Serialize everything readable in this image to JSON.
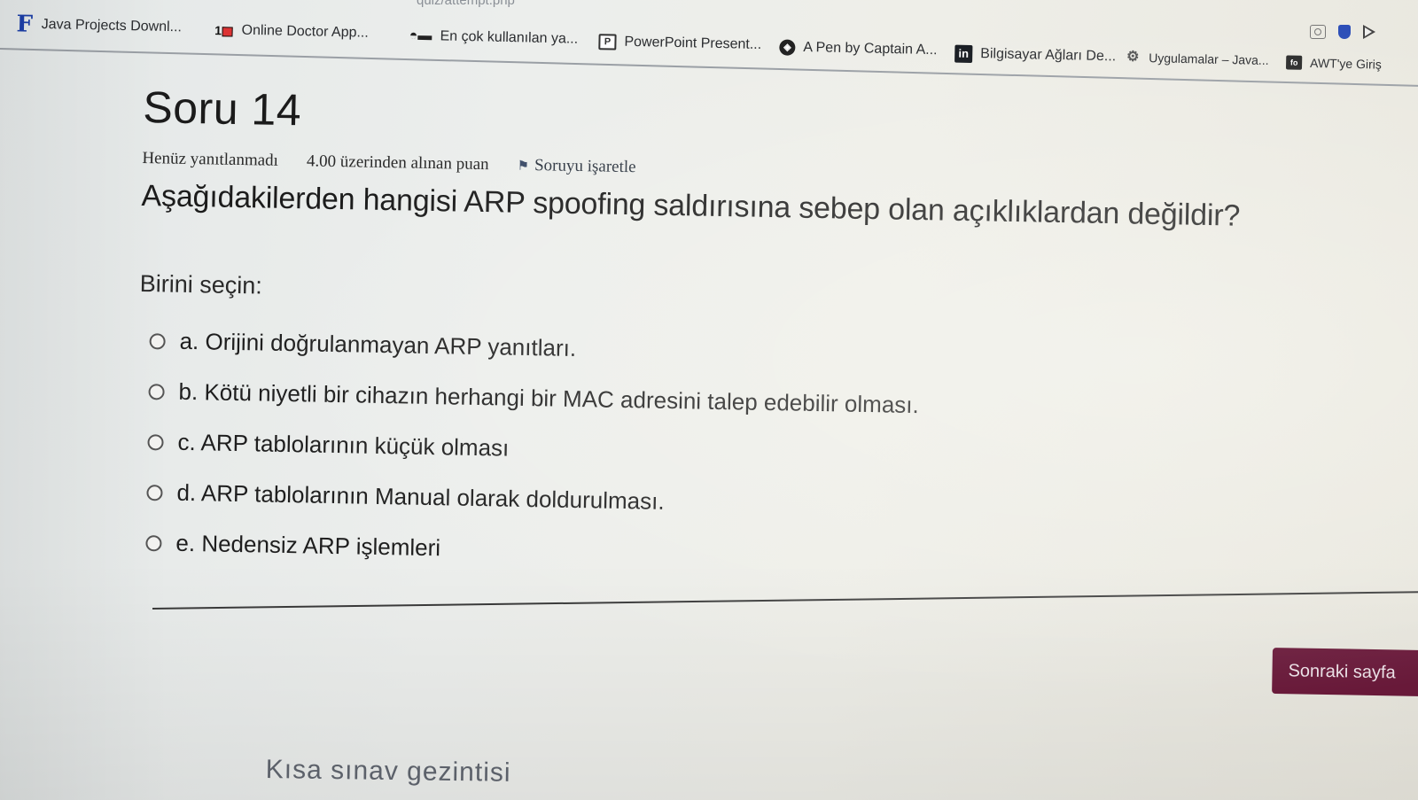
{
  "browser": {
    "url_fragment": "quiz/attempt.php",
    "bookmarks": [
      {
        "label": "Java Projects Downl...",
        "icon": "f-logo-icon"
      },
      {
        "label": "Online Doctor App...",
        "icon": "10-logo-icon"
      },
      {
        "label": "En çok kullanılan ya...",
        "icon": "car-icon"
      },
      {
        "label": "PowerPoint Present...",
        "icon": "powerpoint-icon"
      },
      {
        "label": "A Pen by Captain A...",
        "icon": "codepen-icon"
      },
      {
        "label": "Bilgisayar Ağları De...",
        "icon": "linkedin-icon"
      },
      {
        "label": "Uygulamalar – Java...",
        "icon": "apps-icon"
      },
      {
        "label": "AWT'ye Giriş",
        "icon": "awt-icon"
      }
    ],
    "toolbar_icons": [
      "screenshot-icon",
      "shield-icon",
      "play-icon"
    ]
  },
  "question": {
    "number_title": "Soru 14",
    "status": "Henüz yanıtlanmadı",
    "points": "4.00 üzerinden alınan puan",
    "flag_label": "Soruyu işaretle",
    "text": "Aşağıdakilerden hangisi ARP spoofing saldırısına sebep olan açıklıklardan değildir?",
    "prompt": "Birini seçin:",
    "options": [
      {
        "label": "a. Orijini doğrulanmayan ARP yanıtları."
      },
      {
        "label": "b. Kötü niyetli bir cihazın herhangi bir MAC adresini talep edebilir olması."
      },
      {
        "label": "c. ARP tablolarının küçük olması"
      },
      {
        "label": "d. ARP tablolarının Manual olarak doldurulması."
      },
      {
        "label": "e. Nedensiz ARP işlemleri"
      }
    ]
  },
  "navigation": {
    "next_label": "Sonraki sayfa",
    "quiz_nav_label": "Kısa sınav gezintisi"
  },
  "colors": {
    "next_button": "#6b1a3b",
    "brand_icon": "#1c3fa8"
  }
}
